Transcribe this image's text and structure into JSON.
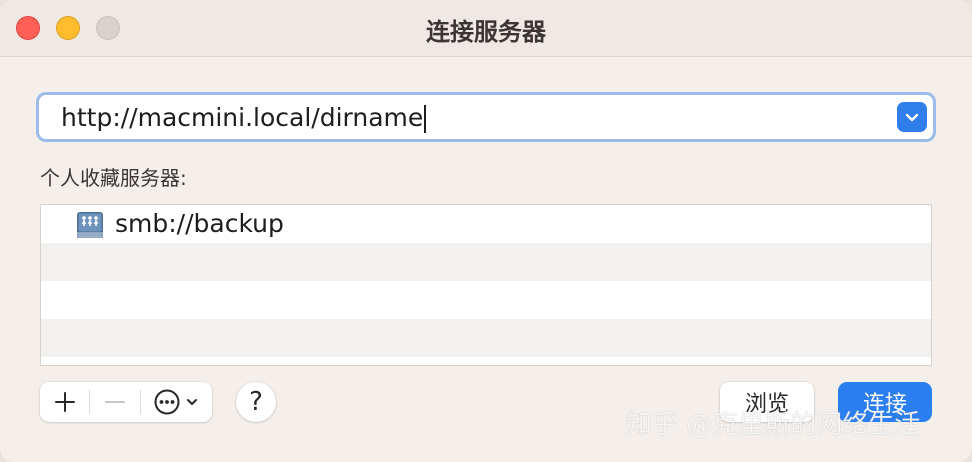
{
  "window": {
    "title": "连接服务器"
  },
  "address": {
    "value": "http://macmini.local/dirname",
    "dropdown_icon": "chevron-down-icon"
  },
  "favorites": {
    "label": "个人收藏服务器:",
    "items": [
      {
        "label": "smb://backup",
        "icon": "network-server-icon"
      }
    ]
  },
  "toolbar": {
    "add_icon": "plus-icon",
    "remove_icon": "minus-icon",
    "action_icon": "ellipsis-circle-icon",
    "help_label": "?"
  },
  "buttons": {
    "browse_label": "浏览",
    "connect_label": "连接"
  },
  "watermark": {
    "text": "知乎 @克里斯的网络生活"
  },
  "colors": {
    "accent": "#2a7ef0",
    "close": "#ff5f57",
    "minimize": "#febc2e",
    "zoom_disabled": "#d8d3cf"
  }
}
